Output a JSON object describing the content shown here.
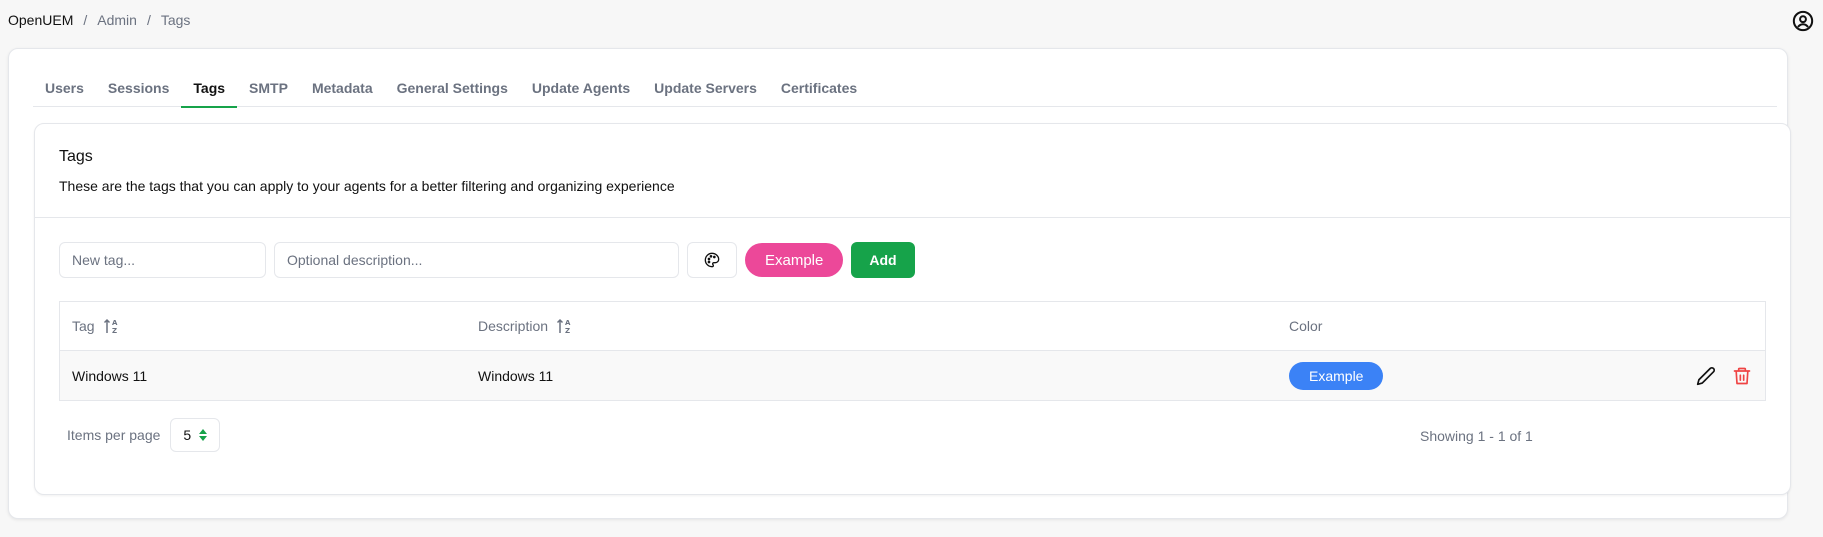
{
  "breadcrumb": {
    "items": [
      "OpenUEM",
      "Admin",
      "Tags"
    ],
    "separator": "/"
  },
  "header": {
    "user_icon": "user-circle-icon"
  },
  "tabs": [
    {
      "label": "Users",
      "active": false
    },
    {
      "label": "Sessions",
      "active": false
    },
    {
      "label": "Tags",
      "active": true
    },
    {
      "label": "SMTP",
      "active": false
    },
    {
      "label": "Metadata",
      "active": false
    },
    {
      "label": "General Settings",
      "active": false
    },
    {
      "label": "Update Agents",
      "active": false
    },
    {
      "label": "Update Servers",
      "active": false
    },
    {
      "label": "Certificates",
      "active": false
    }
  ],
  "card": {
    "title": "Tags",
    "subtitle": "These are the tags that you can apply to your agents for a better filtering and organizing experience"
  },
  "form": {
    "tag_placeholder": "New tag...",
    "tag_value": "",
    "description_placeholder": "Optional description...",
    "description_value": "",
    "palette_icon": "palette-icon",
    "example_label": "Example",
    "example_color": "#ec4899",
    "add_label": "Add"
  },
  "table": {
    "columns": [
      {
        "label": "Tag",
        "sortable": true
      },
      {
        "label": "Description",
        "sortable": true
      },
      {
        "label": "Color",
        "sortable": false
      }
    ],
    "rows": [
      {
        "tag": "Windows 11",
        "description": "Windows 11",
        "color_label": "Example",
        "color": "#3b82f6"
      }
    ]
  },
  "pagination": {
    "items_per_page_label": "Items per page",
    "items_per_page_value": "5",
    "showing": "Showing 1 - 1 of 1"
  },
  "colors": {
    "accent": "#16a34a",
    "danger": "#ef4444"
  }
}
